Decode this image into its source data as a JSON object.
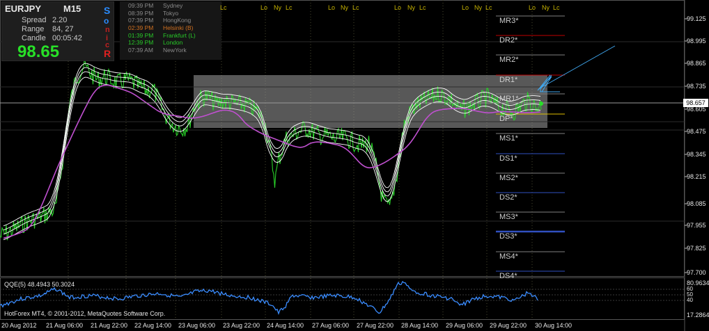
{
  "info": {
    "symbol": "EURJPY",
    "timeframe": "M15",
    "spread_label": "Spread",
    "spread_value": "2.20",
    "range_label": "Range",
    "range_value": "84, 27",
    "candle_label": "Candle",
    "candle_value": "00:05:42",
    "big_value": "98.65",
    "sonic_letters": [
      "S",
      "o",
      "n",
      "i",
      "c",
      "R"
    ]
  },
  "sessions": [
    {
      "time": "09:39 PM",
      "name": "Sydney",
      "color": "#8a8a8a"
    },
    {
      "time": "08:39 PM",
      "name": "Tokyo",
      "color": "#8a8a8a"
    },
    {
      "time": "07:39 PM",
      "name": "HongKong",
      "color": "#8a8a8a"
    },
    {
      "time": "02:39 PM",
      "name": "Helsinki  (B)",
      "color": "#d07020"
    },
    {
      "time": "01:39 PM",
      "name": "Frankfurt  (L)",
      "color": "#28c828"
    },
    {
      "time": "12:39 PM",
      "name": "London",
      "color": "#28c828"
    },
    {
      "time": "07:39 AM",
      "name": "NewYork",
      "color": "#8a8a8a"
    }
  ],
  "session_markers": [
    "Lc",
    "Lo",
    "Ny",
    "Lc",
    "Lo",
    "Ny",
    "Lc",
    "Lo",
    "Ny",
    "Lc",
    "Lo",
    "Ny",
    "Lc",
    "Lo",
    "Ny",
    "Lc"
  ],
  "levels": [
    {
      "label": "MR3*",
      "color": "#808080"
    },
    {
      "label": "DR2*",
      "color": "#c00000"
    },
    {
      "label": "MR2*",
      "color": "#808080"
    },
    {
      "label": "DR1*",
      "color": "#c00000"
    },
    {
      "label": "MR1*",
      "color": "#808080"
    },
    {
      "label": "DP*",
      "color": "#e0c000"
    },
    {
      "label": "MS1*",
      "color": "#808080"
    },
    {
      "label": "DS1*",
      "color": "#3050c0"
    },
    {
      "label": "MS2*",
      "color": "#808080"
    },
    {
      "label": "DS2*",
      "color": "#3050c0"
    },
    {
      "label": "MS3*",
      "color": "#808080"
    },
    {
      "label": "DS3*",
      "color": "#3050c0"
    },
    {
      "label": "MS4*",
      "color": "#808080"
    },
    {
      "label": "DS4*",
      "color": "#3050c0"
    }
  ],
  "price_axis": [
    "99.125",
    "98.995",
    "98.865",
    "98.735",
    "98.605",
    "98.475",
    "98.345",
    "98.215",
    "98.085",
    "97.955",
    "97.825",
    "97.700"
  ],
  "last_price": "98.657",
  "date_axis": [
    "20 Aug 2012",
    "21 Aug 06:00",
    "21 Aug 22:00",
    "22 Aug 14:00",
    "23 Aug 06:00",
    "23 Aug 22:00",
    "24 Aug 14:00",
    "27 Aug 06:00",
    "27 Aug 22:00",
    "28 Aug 14:00",
    "29 Aug 06:00",
    "29 Aug 22:00",
    "30 Aug 14:00"
  ],
  "qqe": {
    "title": "QQE(5) 48.4943 50.3024",
    "max": "80.9634",
    "min": "17.2864",
    "levels": [
      "60",
      "50",
      "40"
    ]
  },
  "footer": "HotForex MT4, © 2001-2012, MetaQuotes Software Corp.",
  "colors": {
    "price_line": "#28d028",
    "ma_slow": "#c050d0",
    "bands": "#ffffff",
    "qqe": "#3a8cff",
    "box": "#808080",
    "arrow": "#40a8f0"
  }
}
